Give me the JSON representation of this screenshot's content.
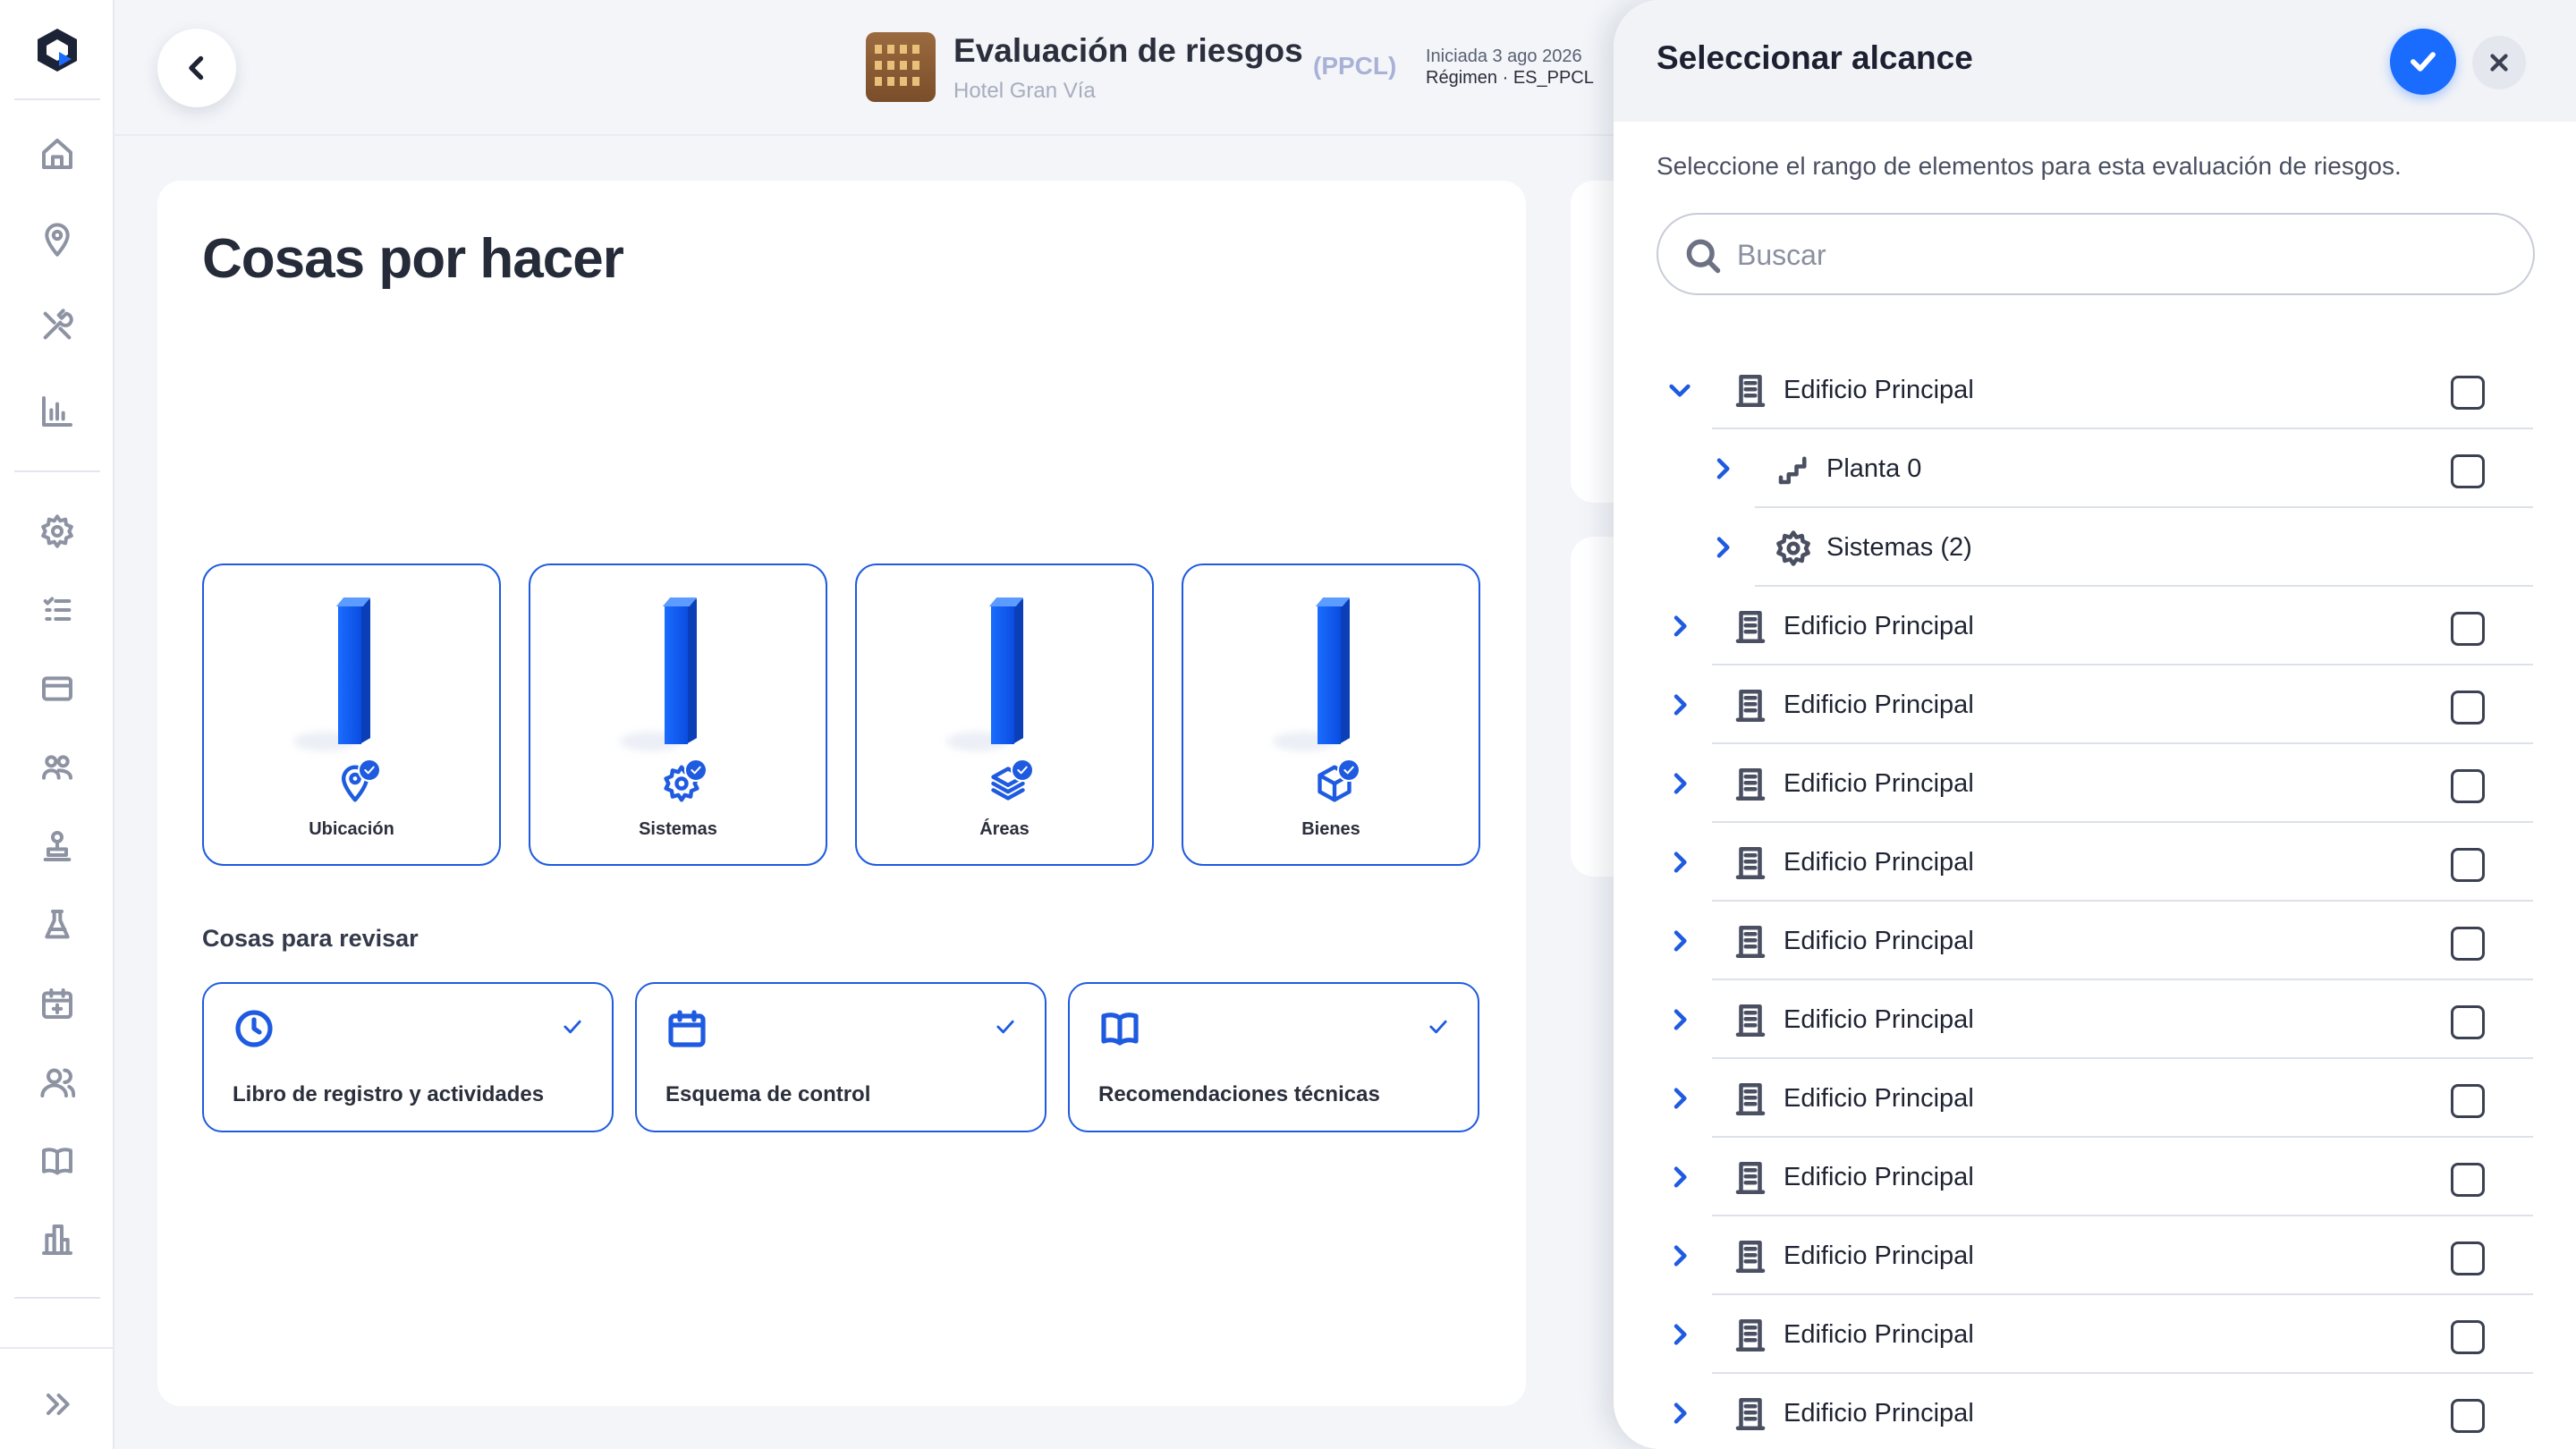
{
  "header": {
    "title": "Evaluación de riesgos",
    "code": "(PPCL)",
    "subtitle": "Hotel Gran Vía",
    "started": "Iniciada 3 ago 2026",
    "regime": "Régimen · ES_PPCL"
  },
  "sidebar": {
    "icons": [
      "home-icon",
      "location-icon",
      "tools-icon",
      "chart-icon",
      "settings-icon",
      "checklist-icon",
      "card-icon",
      "groups-icon",
      "stamp-icon",
      "lab-icon",
      "calendar-icon",
      "users-icon",
      "book-icon",
      "buildings-icon"
    ],
    "expand_icon": "double-chevron-right-icon"
  },
  "main": {
    "title": "Cosas por hacer",
    "tiles": [
      {
        "label": "Ubicación",
        "icon": "location-icon"
      },
      {
        "label": "Sistemas",
        "icon": "settings-icon"
      },
      {
        "label": "Áreas",
        "icon": "layers-icon"
      },
      {
        "label": "Bienes",
        "icon": "cube-icon"
      }
    ],
    "review_title": "Cosas para revisar",
    "reviews": [
      {
        "label": "Libro de registro y actividades",
        "icon": "clock-icon"
      },
      {
        "label": "Esquema de control",
        "icon": "calendar-icon"
      },
      {
        "label": "Recomendaciones técnicas",
        "icon": "book-icon"
      }
    ]
  },
  "panel": {
    "title": "Seleccionar alcance",
    "description": "Seleccione el rango de elementos para esta evaluación de riesgos.",
    "search_placeholder": "Buscar",
    "search_value": "",
    "tree": [
      {
        "label": "Edificio Principal",
        "level": 0,
        "expanded": true,
        "icon": "building-icon",
        "checkbox": true
      },
      {
        "label": "Planta 0",
        "level": 1,
        "expanded": false,
        "icon": "stairs-icon",
        "checkbox": true
      },
      {
        "label": "Sistemas (2)",
        "level": 1,
        "expanded": false,
        "icon": "settings-icon",
        "checkbox": false
      },
      {
        "label": "Edificio Principal",
        "level": 0,
        "expanded": false,
        "icon": "building-icon",
        "checkbox": true
      },
      {
        "label": "Edificio Principal",
        "level": 0,
        "expanded": false,
        "icon": "building-icon",
        "checkbox": true
      },
      {
        "label": "Edificio Principal",
        "level": 0,
        "expanded": false,
        "icon": "building-icon",
        "checkbox": true
      },
      {
        "label": "Edificio Principal",
        "level": 0,
        "expanded": false,
        "icon": "building-icon",
        "checkbox": true
      },
      {
        "label": "Edificio Principal",
        "level": 0,
        "expanded": false,
        "icon": "building-icon",
        "checkbox": true
      },
      {
        "label": "Edificio Principal",
        "level": 0,
        "expanded": false,
        "icon": "building-icon",
        "checkbox": true
      },
      {
        "label": "Edificio Principal",
        "level": 0,
        "expanded": false,
        "icon": "building-icon",
        "checkbox": true
      },
      {
        "label": "Edificio Principal",
        "level": 0,
        "expanded": false,
        "icon": "building-icon",
        "checkbox": true
      },
      {
        "label": "Edificio Principal",
        "level": 0,
        "expanded": false,
        "icon": "building-icon",
        "checkbox": true
      },
      {
        "label": "Edificio Principal",
        "level": 0,
        "expanded": false,
        "icon": "building-icon",
        "checkbox": true
      },
      {
        "label": "Edificio Principal",
        "level": 0,
        "expanded": false,
        "icon": "building-icon",
        "checkbox": true
      }
    ]
  },
  "colors": {
    "accent": "#1a6cff",
    "border_accent": "#1f5be0",
    "muted": "#8d93a3"
  }
}
